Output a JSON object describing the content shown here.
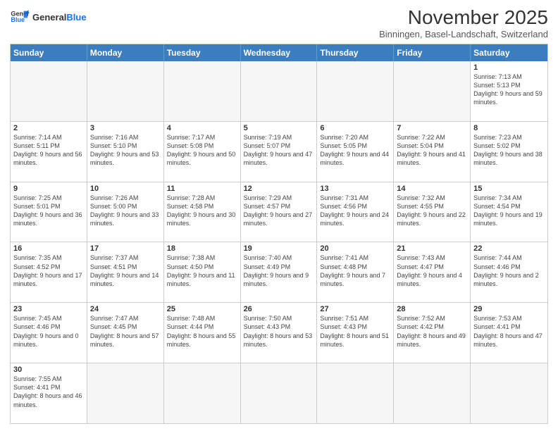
{
  "header": {
    "logo_general": "General",
    "logo_blue": "Blue",
    "main_title": "November 2025",
    "subtitle": "Binningen, Basel-Landschaft, Switzerland"
  },
  "calendar": {
    "days_of_week": [
      "Sunday",
      "Monday",
      "Tuesday",
      "Wednesday",
      "Thursday",
      "Friday",
      "Saturday"
    ],
    "weeks": [
      [
        {
          "day": "",
          "empty": true
        },
        {
          "day": "",
          "empty": true
        },
        {
          "day": "",
          "empty": true
        },
        {
          "day": "",
          "empty": true
        },
        {
          "day": "",
          "empty": true
        },
        {
          "day": "",
          "empty": true
        },
        {
          "day": "1",
          "sunrise": "7:13 AM",
          "sunset": "5:13 PM",
          "daylight": "9 hours and 59 minutes."
        }
      ],
      [
        {
          "day": "2",
          "sunrise": "7:14 AM",
          "sunset": "5:11 PM",
          "daylight": "9 hours and 56 minutes."
        },
        {
          "day": "3",
          "sunrise": "7:16 AM",
          "sunset": "5:10 PM",
          "daylight": "9 hours and 53 minutes."
        },
        {
          "day": "4",
          "sunrise": "7:17 AM",
          "sunset": "5:08 PM",
          "daylight": "9 hours and 50 minutes."
        },
        {
          "day": "5",
          "sunrise": "7:19 AM",
          "sunset": "5:07 PM",
          "daylight": "9 hours and 47 minutes."
        },
        {
          "day": "6",
          "sunrise": "7:20 AM",
          "sunset": "5:05 PM",
          "daylight": "9 hours and 44 minutes."
        },
        {
          "day": "7",
          "sunrise": "7:22 AM",
          "sunset": "5:04 PM",
          "daylight": "9 hours and 41 minutes."
        },
        {
          "day": "8",
          "sunrise": "7:23 AM",
          "sunset": "5:02 PM",
          "daylight": "9 hours and 38 minutes."
        }
      ],
      [
        {
          "day": "9",
          "sunrise": "7:25 AM",
          "sunset": "5:01 PM",
          "daylight": "9 hours and 36 minutes."
        },
        {
          "day": "10",
          "sunrise": "7:26 AM",
          "sunset": "5:00 PM",
          "daylight": "9 hours and 33 minutes."
        },
        {
          "day": "11",
          "sunrise": "7:28 AM",
          "sunset": "4:58 PM",
          "daylight": "9 hours and 30 minutes."
        },
        {
          "day": "12",
          "sunrise": "7:29 AM",
          "sunset": "4:57 PM",
          "daylight": "9 hours and 27 minutes."
        },
        {
          "day": "13",
          "sunrise": "7:31 AM",
          "sunset": "4:56 PM",
          "daylight": "9 hours and 24 minutes."
        },
        {
          "day": "14",
          "sunrise": "7:32 AM",
          "sunset": "4:55 PM",
          "daylight": "9 hours and 22 minutes."
        },
        {
          "day": "15",
          "sunrise": "7:34 AM",
          "sunset": "4:54 PM",
          "daylight": "9 hours and 19 minutes."
        }
      ],
      [
        {
          "day": "16",
          "sunrise": "7:35 AM",
          "sunset": "4:52 PM",
          "daylight": "9 hours and 17 minutes."
        },
        {
          "day": "17",
          "sunrise": "7:37 AM",
          "sunset": "4:51 PM",
          "daylight": "9 hours and 14 minutes."
        },
        {
          "day": "18",
          "sunrise": "7:38 AM",
          "sunset": "4:50 PM",
          "daylight": "9 hours and 11 minutes."
        },
        {
          "day": "19",
          "sunrise": "7:40 AM",
          "sunset": "4:49 PM",
          "daylight": "9 hours and 9 minutes."
        },
        {
          "day": "20",
          "sunrise": "7:41 AM",
          "sunset": "4:48 PM",
          "daylight": "9 hours and 7 minutes."
        },
        {
          "day": "21",
          "sunrise": "7:43 AM",
          "sunset": "4:47 PM",
          "daylight": "9 hours and 4 minutes."
        },
        {
          "day": "22",
          "sunrise": "7:44 AM",
          "sunset": "4:46 PM",
          "daylight": "9 hours and 2 minutes."
        }
      ],
      [
        {
          "day": "23",
          "sunrise": "7:45 AM",
          "sunset": "4:46 PM",
          "daylight": "9 hours and 0 minutes."
        },
        {
          "day": "24",
          "sunrise": "7:47 AM",
          "sunset": "4:45 PM",
          "daylight": "8 hours and 57 minutes."
        },
        {
          "day": "25",
          "sunrise": "7:48 AM",
          "sunset": "4:44 PM",
          "daylight": "8 hours and 55 minutes."
        },
        {
          "day": "26",
          "sunrise": "7:50 AM",
          "sunset": "4:43 PM",
          "daylight": "8 hours and 53 minutes."
        },
        {
          "day": "27",
          "sunrise": "7:51 AM",
          "sunset": "4:43 PM",
          "daylight": "8 hours and 51 minutes."
        },
        {
          "day": "28",
          "sunrise": "7:52 AM",
          "sunset": "4:42 PM",
          "daylight": "8 hours and 49 minutes."
        },
        {
          "day": "29",
          "sunrise": "7:53 AM",
          "sunset": "4:41 PM",
          "daylight": "8 hours and 47 minutes."
        }
      ],
      [
        {
          "day": "30",
          "sunrise": "7:55 AM",
          "sunset": "4:41 PM",
          "daylight": "8 hours and 46 minutes."
        },
        {
          "day": "",
          "empty": true
        },
        {
          "day": "",
          "empty": true
        },
        {
          "day": "",
          "empty": true
        },
        {
          "day": "",
          "empty": true
        },
        {
          "day": "",
          "empty": true
        },
        {
          "day": "",
          "empty": true
        }
      ]
    ]
  }
}
